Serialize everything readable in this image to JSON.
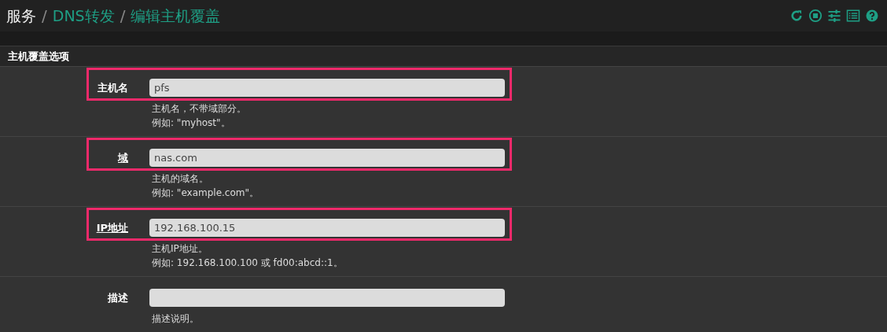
{
  "breadcrumb": [
    {
      "label": "服务",
      "link": false
    },
    {
      "separator": "/",
      "label": "DNS转发",
      "link": true
    },
    {
      "separator": "/",
      "label": "编辑主机覆盖",
      "link": true
    }
  ],
  "section_title": "主机覆盖选项",
  "fields": [
    {
      "label": "主机名",
      "required": false,
      "highlighted": true,
      "value": "pfs",
      "help": [
        "主机名，不带域部分。",
        "例如: \"myhost\"。"
      ]
    },
    {
      "label": "域",
      "required": true,
      "highlighted": true,
      "value": "nas.com",
      "help": [
        "主机的域名。",
        "例如: \"example.com\"。"
      ]
    },
    {
      "label": "IP地址",
      "required": true,
      "highlighted": true,
      "value": "192.168.100.15",
      "help": [
        "主机IP地址。",
        "例如: 192.168.100.100 或 fd00:abcd::1。"
      ]
    },
    {
      "label": "描述",
      "required": false,
      "highlighted": false,
      "help": [
        "描述说明。"
      ]
    }
  ]
}
